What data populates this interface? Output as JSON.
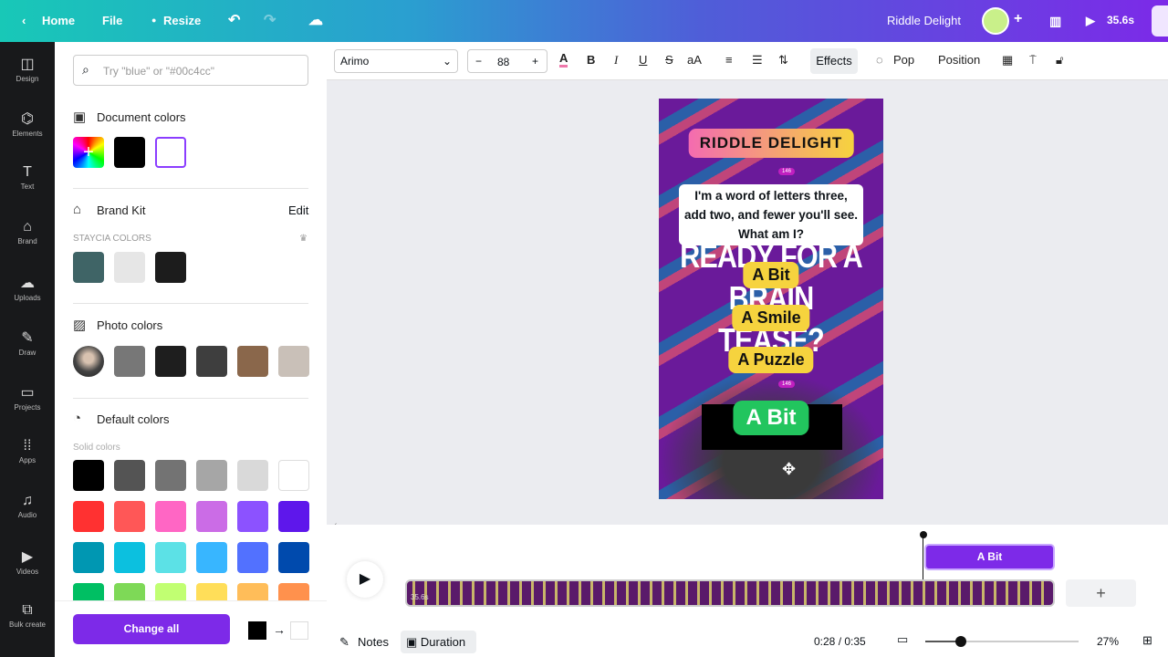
{
  "topbar": {
    "home": "Home",
    "file": "File",
    "resize": "Resize",
    "title": "Riddle Delight",
    "duration": "35.6s"
  },
  "sidebar": {
    "items": [
      {
        "label": "Design",
        "icon": "layout-icon"
      },
      {
        "label": "Elements",
        "icon": "shapes-icon"
      },
      {
        "label": "Text",
        "icon": "text-icon"
      },
      {
        "label": "Brand",
        "icon": "brand-icon"
      },
      {
        "label": "Uploads",
        "icon": "cloud-upload-icon"
      },
      {
        "label": "Draw",
        "icon": "pen-icon"
      },
      {
        "label": "Projects",
        "icon": "folder-icon"
      },
      {
        "label": "Apps",
        "icon": "grid-icon"
      },
      {
        "label": "Audio",
        "icon": "music-icon"
      },
      {
        "label": "Videos",
        "icon": "video-icon"
      },
      {
        "label": "Bulk create",
        "icon": "bulk-icon"
      }
    ]
  },
  "panel": {
    "search_placeholder": "Try \"blue\" or \"#00c4cc\"",
    "document_colors": {
      "title": "Document colors",
      "swatches": [
        "#000000",
        "#ffffff"
      ]
    },
    "brand_kit": {
      "title": "Brand Kit",
      "edit": "Edit",
      "subtitle": "STAYCIA COLORS",
      "swatches": [
        "#3f6466",
        "#e6e6e6",
        "#1c1c1c"
      ]
    },
    "photo_colors": {
      "title": "Photo colors",
      "swatches": [
        "#777777",
        "#1e1e1e",
        "#3e3e3e",
        "#8a674b",
        "#c9c0b8"
      ]
    },
    "default_colors": {
      "title": "Default colors",
      "subtitle": "Solid colors",
      "swatches": [
        "#000000",
        "#545454",
        "#737373",
        "#a6a6a6",
        "#d9d9d9",
        "#ffffff",
        "#ff3131",
        "#ff5757",
        "#ff66c4",
        "#cb6ce6",
        "#8c52ff",
        "#5e17eb",
        "#0097b2",
        "#0cc0df",
        "#5ce1e6",
        "#38b6ff",
        "#5271ff",
        "#004aad",
        "#00bf63",
        "#7ed957",
        "#c1ff72",
        "#ffde59",
        "#ffbd59",
        "#ff914d"
      ]
    },
    "change_all": "Change all"
  },
  "toolbar": {
    "font": "Arimo",
    "size": "88",
    "effects": "Effects",
    "pop": "Pop",
    "position": "Position"
  },
  "canvas": {
    "title": "RIDDLE DELIGHT",
    "badge": "146",
    "riddle": "I'm a word of letters three, add two, and fewer you'll see. What am I?",
    "bg_text_1": "READY FOR A",
    "bg_text_2": "BRAIN TEASE?",
    "options": [
      "A Bit",
      "A Smile",
      "A Puzzle"
    ],
    "answer": "A Bit",
    "badge2": "146"
  },
  "timeline": {
    "clip_label": "A Bit",
    "track_duration": "35.6s",
    "notes": "Notes",
    "duration": "Duration",
    "time": "0:28 / 0:35",
    "zoom": "27%",
    "zoom_level": 27
  },
  "colors": {
    "accent": "#7d2ae8",
    "answer": "#22c55e",
    "option": "#f6d33e"
  }
}
